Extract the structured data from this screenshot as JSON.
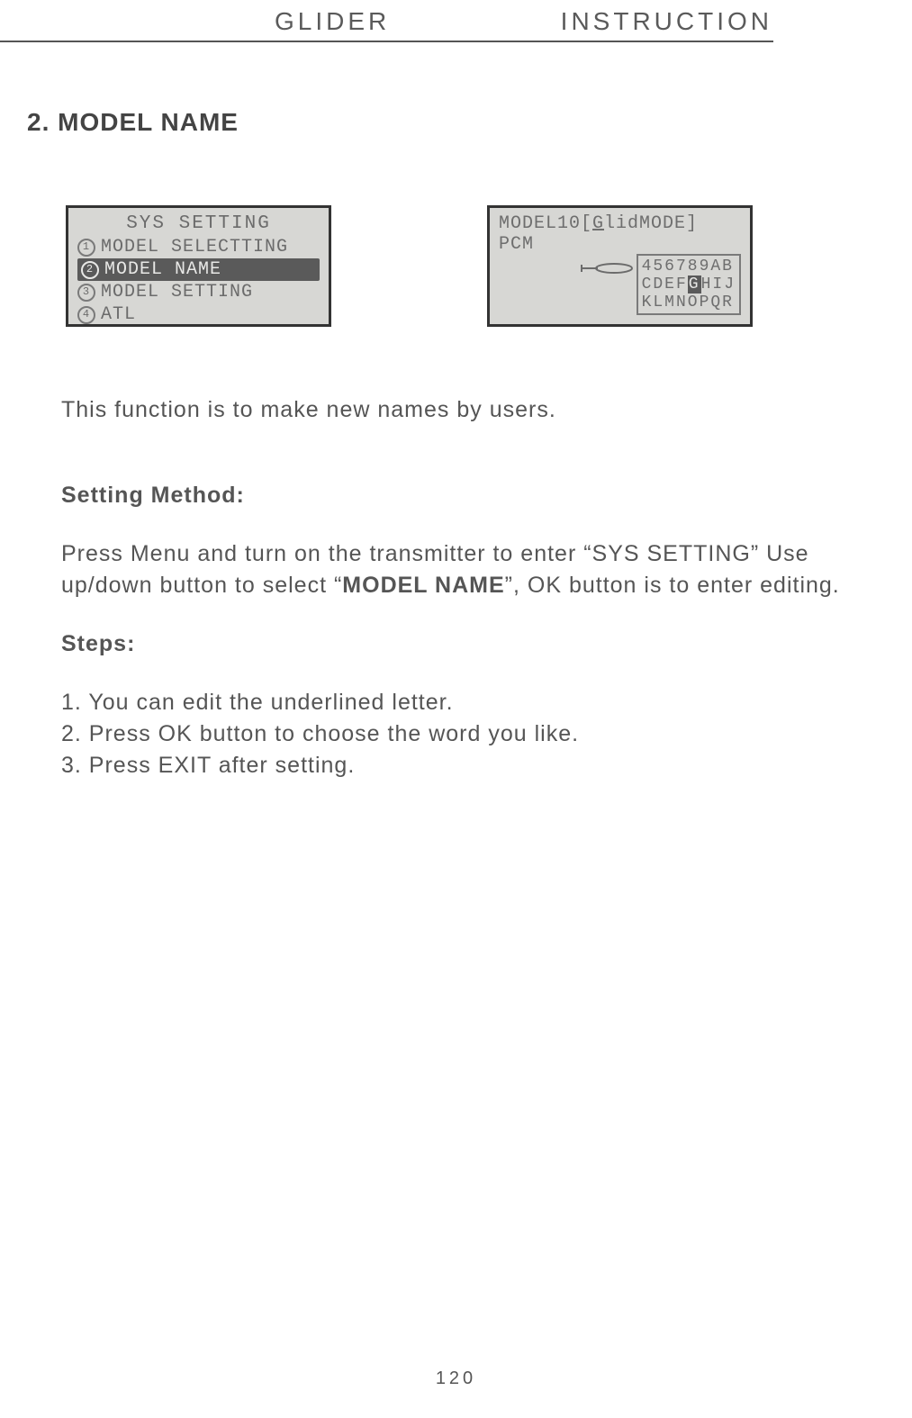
{
  "header": {
    "left": "GLIDER",
    "right": "INSTRUCTION"
  },
  "section_title": "2. MODEL NAME",
  "screenshot1": {
    "title": "SYS SETTING",
    "items": [
      {
        "n": "1",
        "label": "MODEL SELECTTING",
        "selected": false
      },
      {
        "n": "2",
        "label": "MODEL NAME",
        "selected": true
      },
      {
        "n": "3",
        "label": "MODEL SETTING",
        "selected": false
      },
      {
        "n": "4",
        "label": "ATL",
        "selected": false
      }
    ]
  },
  "screenshot2": {
    "top_line_a": "MODEL10[",
    "top_line_u": "G",
    "top_line_b": "lidMODE] PCM",
    "grid": {
      "r1": "456789AB",
      "r2a": "CDEF",
      "r2h": "G",
      "r2b": "HIJ",
      "r3": "KLMNOPQR"
    }
  },
  "intro": "This function is to make new names by users.",
  "setting_method_h": "Setting Method:",
  "setting_method_p1a": "Press Menu and turn on the transmitter to enter “SYS SETTING” Use up/down button to select “",
  "setting_method_p1b": "MODEL NAME",
  "setting_method_p1c": "”, OK button is to enter editing.",
  "steps_h": "Steps:",
  "steps": {
    "s1": "1. You can edit the underlined letter.",
    "s2": "2. Press OK button to choose the word you like.",
    "s3": "3. Press EXIT after setting."
  },
  "page_number": "120"
}
